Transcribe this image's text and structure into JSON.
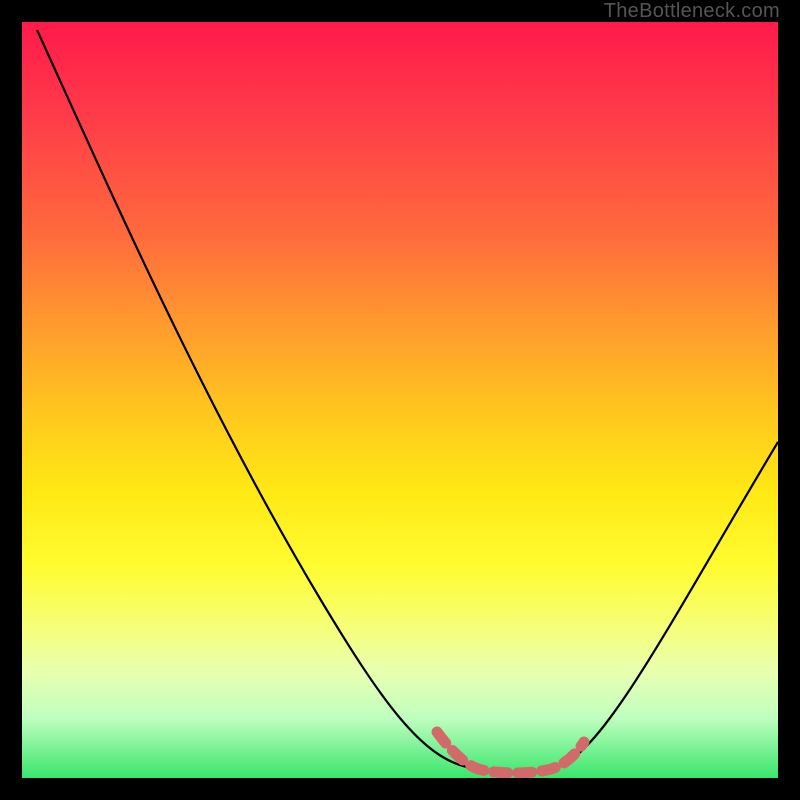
{
  "watermark": "TheBottleneck.com",
  "chart_data": {
    "type": "line",
    "title": "",
    "xlabel": "",
    "ylabel": "",
    "xlim": [
      0,
      100
    ],
    "ylim": [
      0,
      100
    ],
    "series": [
      {
        "name": "bottleneck-curve",
        "x": [
          2,
          10,
          20,
          30,
          40,
          50,
          55,
          58,
          60,
          62,
          64,
          66,
          68,
          70,
          75,
          80,
          85,
          90,
          95,
          100
        ],
        "y": [
          99,
          80,
          62,
          46,
          32,
          18,
          11,
          7,
          4,
          2,
          1,
          1,
          1,
          2,
          6,
          13,
          22,
          33,
          44,
          55
        ]
      },
      {
        "name": "optimal-range",
        "x": [
          55,
          58,
          60,
          62,
          64,
          66,
          68,
          70,
          72
        ],
        "y": [
          7,
          4,
          3,
          2,
          1,
          1,
          2,
          3,
          5
        ]
      }
    ],
    "colors": {
      "curve": "#000000",
      "optimal": "#d36a6a"
    }
  }
}
